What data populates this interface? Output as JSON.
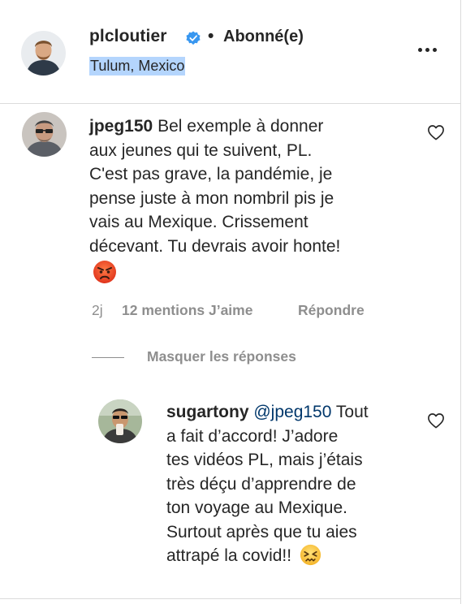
{
  "post_header": {
    "username": "plcloutier",
    "verified_icon": "verified-badge-icon",
    "separator": "•",
    "follow_state": "Abonné(e)",
    "location": "Tulum, Mexico",
    "more_icon": "more-options-icon",
    "colors": {
      "verified": "#3897f0",
      "selection_highlight": "#b4d5fd"
    }
  },
  "comment": {
    "author": "jpeg150",
    "text_lines": [
      "Bel exemple à donner",
      "aux jeunes qui te suivent, PL.",
      "C'est pas grave, la pandémie, je",
      "pense juste à mon nombril pis je",
      "vais au Mexique. Crissement",
      "décevant. Tu devrais avoir honte!"
    ],
    "emoji_icon": "angry-face-emoji-icon",
    "time": "2j",
    "likes": "12 mentions J’aime",
    "reply_label": "Répondre",
    "hide_replies_label": "Masquer les réponses"
  },
  "reply": {
    "author": "sugartony",
    "mention": "@jpeg150",
    "text_first": "Tout",
    "text_lines": [
      "a fait d’accord! J’adore",
      "tes vidéos PL, mais j’étais",
      "très déçu d’apprendre de",
      "ton voyage au Mexique.",
      "Surtout après que tu aies",
      "attrapé la covid!!"
    ],
    "emoji_icon": "confounded-face-emoji-icon"
  }
}
